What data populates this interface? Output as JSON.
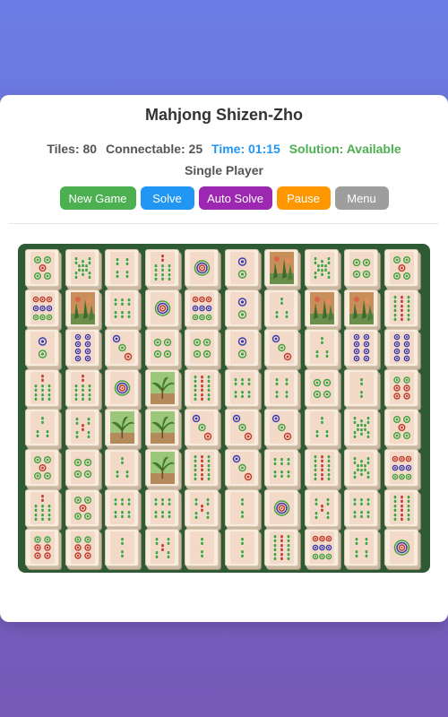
{
  "title": "Mahjong Shizen-Zho",
  "stats": {
    "tiles": "Tiles: 80",
    "connectable": "Connectable: 25",
    "time": "Time: 01:15",
    "solution": "Solution: Available"
  },
  "mode": "Single Player",
  "buttons": {
    "new_game": "New Game",
    "solve": "Solve",
    "auto_solve": "Auto Solve",
    "pause": "Pause",
    "menu": "Menu"
  },
  "colors": {
    "board": "#2e5a34",
    "tile_face": "#f3d9c7",
    "green": "#3fa33f",
    "blue": "#3a3ab0",
    "red": "#c0392b"
  },
  "board": {
    "rows": [
      [
        "circles-5",
        "bamboo-8",
        "bamboo-4",
        "bamboo-7",
        "circles-1",
        "circles-2",
        "flower",
        "bamboo-8",
        "circles-4",
        "circles-5"
      ],
      [
        "circles-9",
        "flower",
        "bamboo-6",
        "circles-1",
        "circles-9",
        "circles-2",
        "bamboo-3",
        "flower",
        "flower",
        "bamboo-9"
      ],
      [
        "circles-2",
        "circles-8",
        "circles-3",
        "circles-4",
        "circles-4",
        "circles-2",
        "circles-3",
        "bamboo-3",
        "circles-8",
        "circles-8"
      ],
      [
        "bamboo-7",
        "bamboo-7",
        "circles-1",
        "bamboo-scene",
        "bamboo-9",
        "bamboo-6",
        "bamboo-4",
        "circles-4",
        "bamboo-2",
        "circles-6"
      ],
      [
        "bamboo-3",
        "bamboo-5",
        "bamboo-scene",
        "bamboo-scene",
        "circles-3",
        "circles-3",
        "circles-3",
        "bamboo-3",
        "bamboo-8",
        "circles-5"
      ],
      [
        "circles-5",
        "circles-4",
        "bamboo-3",
        "bamboo-scene",
        "bamboo-9",
        "circles-3",
        "bamboo-6",
        "bamboo-9",
        "bamboo-8",
        "circles-9"
      ],
      [
        "bamboo-7",
        "circles-5",
        "bamboo-6",
        "bamboo-6",
        "bamboo-5",
        "bamboo-2",
        "circles-1",
        "bamboo-5",
        "bamboo-6",
        "bamboo-9"
      ],
      [
        "circles-6",
        "circles-6",
        "bamboo-2",
        "bamboo-5",
        "bamboo-2",
        "bamboo-2",
        "bamboo-9",
        "circles-9",
        "bamboo-4",
        "circles-1"
      ]
    ]
  }
}
